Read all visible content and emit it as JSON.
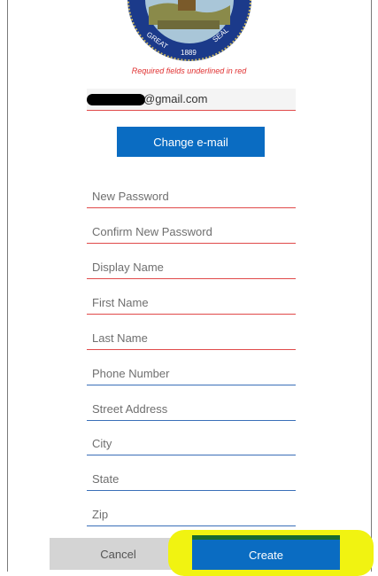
{
  "seal": {
    "text_top": "GREAT",
    "text_right": "SEAL",
    "year": "1889",
    "colors": {
      "ring": "#1b3a8a",
      "text": "#ffffff",
      "sky": "#a9c6d8",
      "land": "#8a8a4a"
    }
  },
  "form": {
    "required_note": "Required fields underlined in red",
    "email": {
      "domain": "@gmail.com"
    },
    "change_email_label": "Change e-mail",
    "fields": [
      {
        "placeholder": "New Password",
        "required": true
      },
      {
        "placeholder": "Confirm New Password",
        "required": true
      },
      {
        "placeholder": "Display Name",
        "required": true
      },
      {
        "placeholder": "First Name",
        "required": true
      },
      {
        "placeholder": "Last Name",
        "required": true
      },
      {
        "placeholder": "Phone Number",
        "required": false
      },
      {
        "placeholder": "Street Address",
        "required": false
      },
      {
        "placeholder": "City",
        "required": false
      },
      {
        "placeholder": "State",
        "required": false
      },
      {
        "placeholder": "Zip",
        "required": false
      }
    ]
  },
  "actions": {
    "cancel_label": "Cancel",
    "create_label": "Create"
  },
  "colors": {
    "primary": "#0a6cc2",
    "required_underline": "#e04a4a",
    "optional_underline": "#3a6fb8",
    "highlight": "#f1f311"
  }
}
